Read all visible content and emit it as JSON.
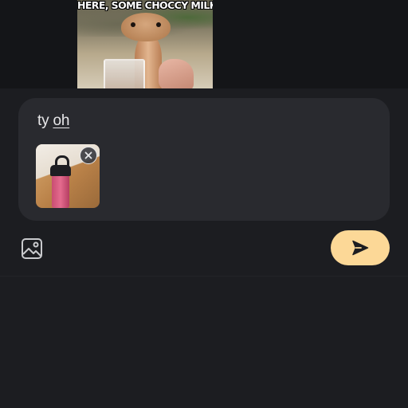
{
  "chat_history": {
    "meme": {
      "caption": "HERE, SOME CHOCCY MILK"
    }
  },
  "composer": {
    "message_text": "ty ",
    "misspelled_word": "oh",
    "attachment": {
      "remove_icon": "close-icon"
    }
  },
  "toolbar": {
    "image_icon": "image-icon",
    "send_icon": "send-icon"
  },
  "colors": {
    "background": "#1c1d21",
    "composer_background": "#292a2f",
    "send_button": "#fcd897",
    "text": "#e8e8ea"
  }
}
